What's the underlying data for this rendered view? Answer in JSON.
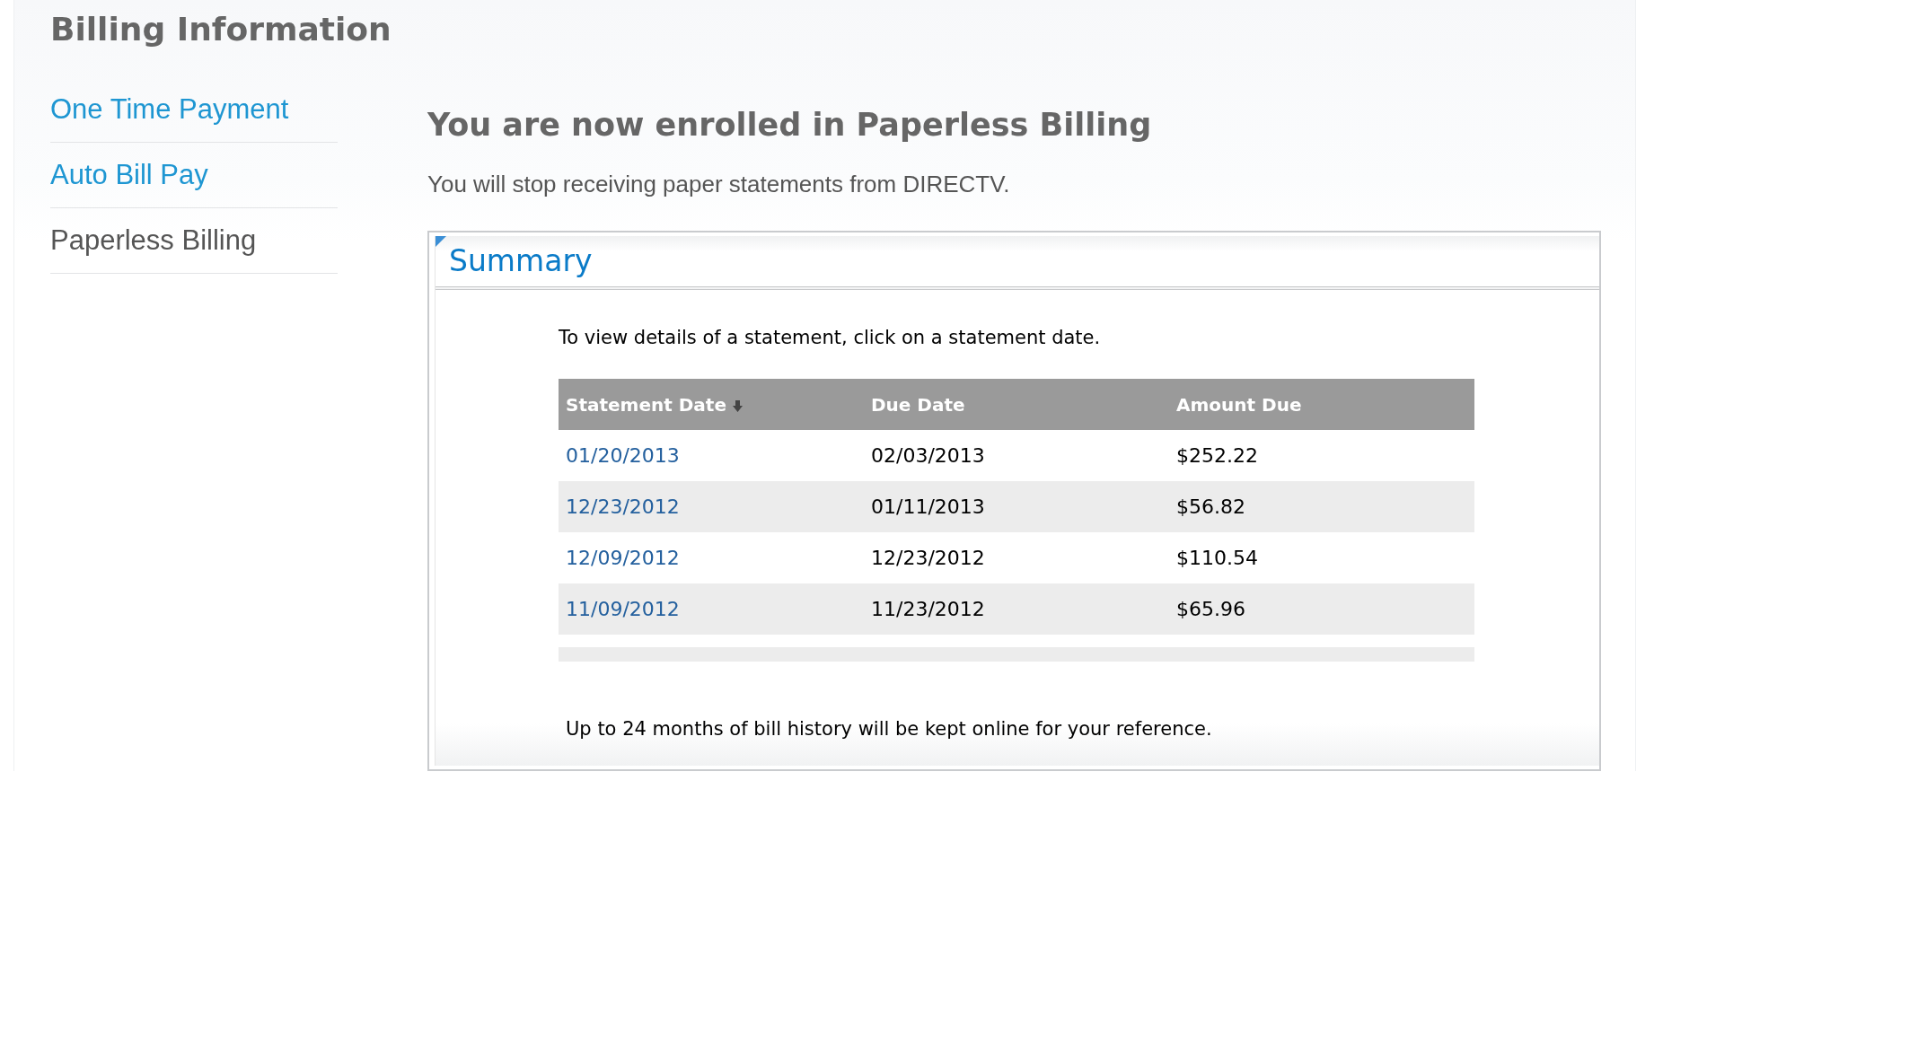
{
  "page_title": "Billing Information",
  "sidebar": {
    "items": [
      {
        "label": "One Time Payment",
        "selected": false
      },
      {
        "label": "Auto Bill Pay",
        "selected": false
      },
      {
        "label": "Paperless Billing",
        "selected": true
      }
    ]
  },
  "heading": "You are now enrolled in Paperless Billing",
  "message": "You will stop receiving paper statements from DIRECTV.",
  "summary": {
    "title": "Summary",
    "instructions": "To view details of a statement, click on a statement date.",
    "table": {
      "columns": [
        {
          "label": "Statement Date",
          "sorted": true
        },
        {
          "label": "Due Date",
          "sorted": false
        },
        {
          "label": "Amount Due",
          "sorted": false
        }
      ],
      "rows": [
        [
          "01/20/2013",
          "02/03/2013",
          "$252.22"
        ],
        [
          "12/23/2012",
          "01/11/2013",
          "$56.82"
        ],
        [
          "12/09/2012",
          "12/23/2012",
          "$110.54"
        ],
        [
          "11/09/2012",
          "11/23/2012",
          "$65.96"
        ]
      ]
    },
    "footnote": "Up to 24 months of bill history will be kept online for your reference."
  }
}
